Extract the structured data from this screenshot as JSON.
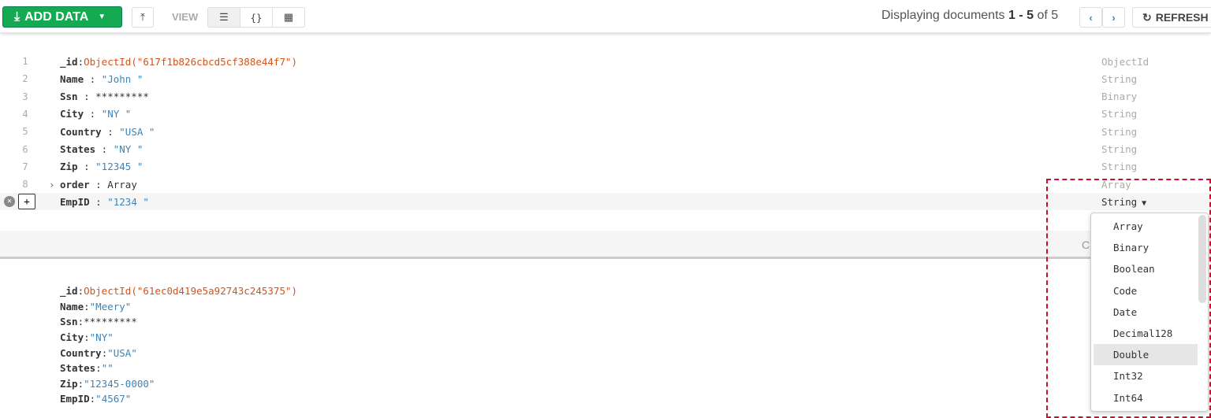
{
  "toolbar": {
    "add_data": "ADD DATA",
    "view_label": "VIEW",
    "display_prefix": "Displaying documents",
    "range_start": "1",
    "range_sep": " - ",
    "range_end": "5",
    "of_label": "of 5",
    "refresh": "REFRESH",
    "icons": [
      "download-icon",
      "caret-down-icon",
      "import-icon",
      "list-view-icon",
      "json-view-icon",
      "table-view-icon",
      "chevron-left-icon",
      "chevron-right-icon",
      "refresh-icon"
    ]
  },
  "doc1": {
    "fields": [
      {
        "n": "1",
        "key": "_id",
        "sep": ":",
        "value": "ObjectId(\"617f1b826cbcd5cf388e44f7\")",
        "kind": "oid",
        "type": "ObjectId"
      },
      {
        "n": "2",
        "key": "Name",
        "sep": " : ",
        "value": "\"John \"",
        "kind": "str",
        "type": "String"
      },
      {
        "n": "3",
        "key": "Ssn",
        "sep": " : ",
        "value": "*********",
        "kind": "plain",
        "type": "Binary"
      },
      {
        "n": "4",
        "key": "City",
        "sep": " : ",
        "value": "\"NY \"",
        "kind": "str",
        "type": "String"
      },
      {
        "n": "5",
        "key": "Country",
        "sep": " : ",
        "value": "\"USA \"",
        "kind": "str",
        "type": "String"
      },
      {
        "n": "6",
        "key": "States",
        "sep": " : ",
        "value": "\"NY \"",
        "kind": "str",
        "type": "String"
      },
      {
        "n": "7",
        "key": "Zip",
        "sep": " : ",
        "value": "\"12345 \"",
        "kind": "str",
        "type": "String"
      },
      {
        "n": "8",
        "key": "order",
        "sep": " : ",
        "value": "Array",
        "kind": "plain",
        "type": "Array"
      }
    ],
    "editing": {
      "key": "EmpID",
      "sep": " : ",
      "value": "\"1234 \"",
      "type": "String"
    },
    "footer_partial": "C"
  },
  "doc2": {
    "fields": [
      {
        "key": "_id",
        "value": "ObjectId(\"61ec0d419e5a92743c245375\")",
        "kind": "oid"
      },
      {
        "key": "Name",
        "value": "\"Meery\"",
        "kind": "str"
      },
      {
        "key": "Ssn",
        "value": "*********",
        "kind": "plain"
      },
      {
        "key": "City",
        "value": "\"NY\"",
        "kind": "str"
      },
      {
        "key": "Country",
        "value": "\"USA\"",
        "kind": "str"
      },
      {
        "key": "States",
        "value": "\"\"",
        "kind": "str"
      },
      {
        "key": "Zip",
        "value": "\"12345-0000\"",
        "kind": "str"
      },
      {
        "key": "EmpID",
        "value": "\"4567\"",
        "kind": "str"
      }
    ]
  },
  "type_dropdown": {
    "options": [
      "Array",
      "Binary",
      "Boolean",
      "Code",
      "Date",
      "Decimal128",
      "Double",
      "Int32",
      "Int64"
    ],
    "highlighted": "Double"
  },
  "colors": {
    "accent": "#13aa52",
    "string": "#3f84b4",
    "objectid": "#d2541b",
    "highlight_box": "#c8102e"
  }
}
